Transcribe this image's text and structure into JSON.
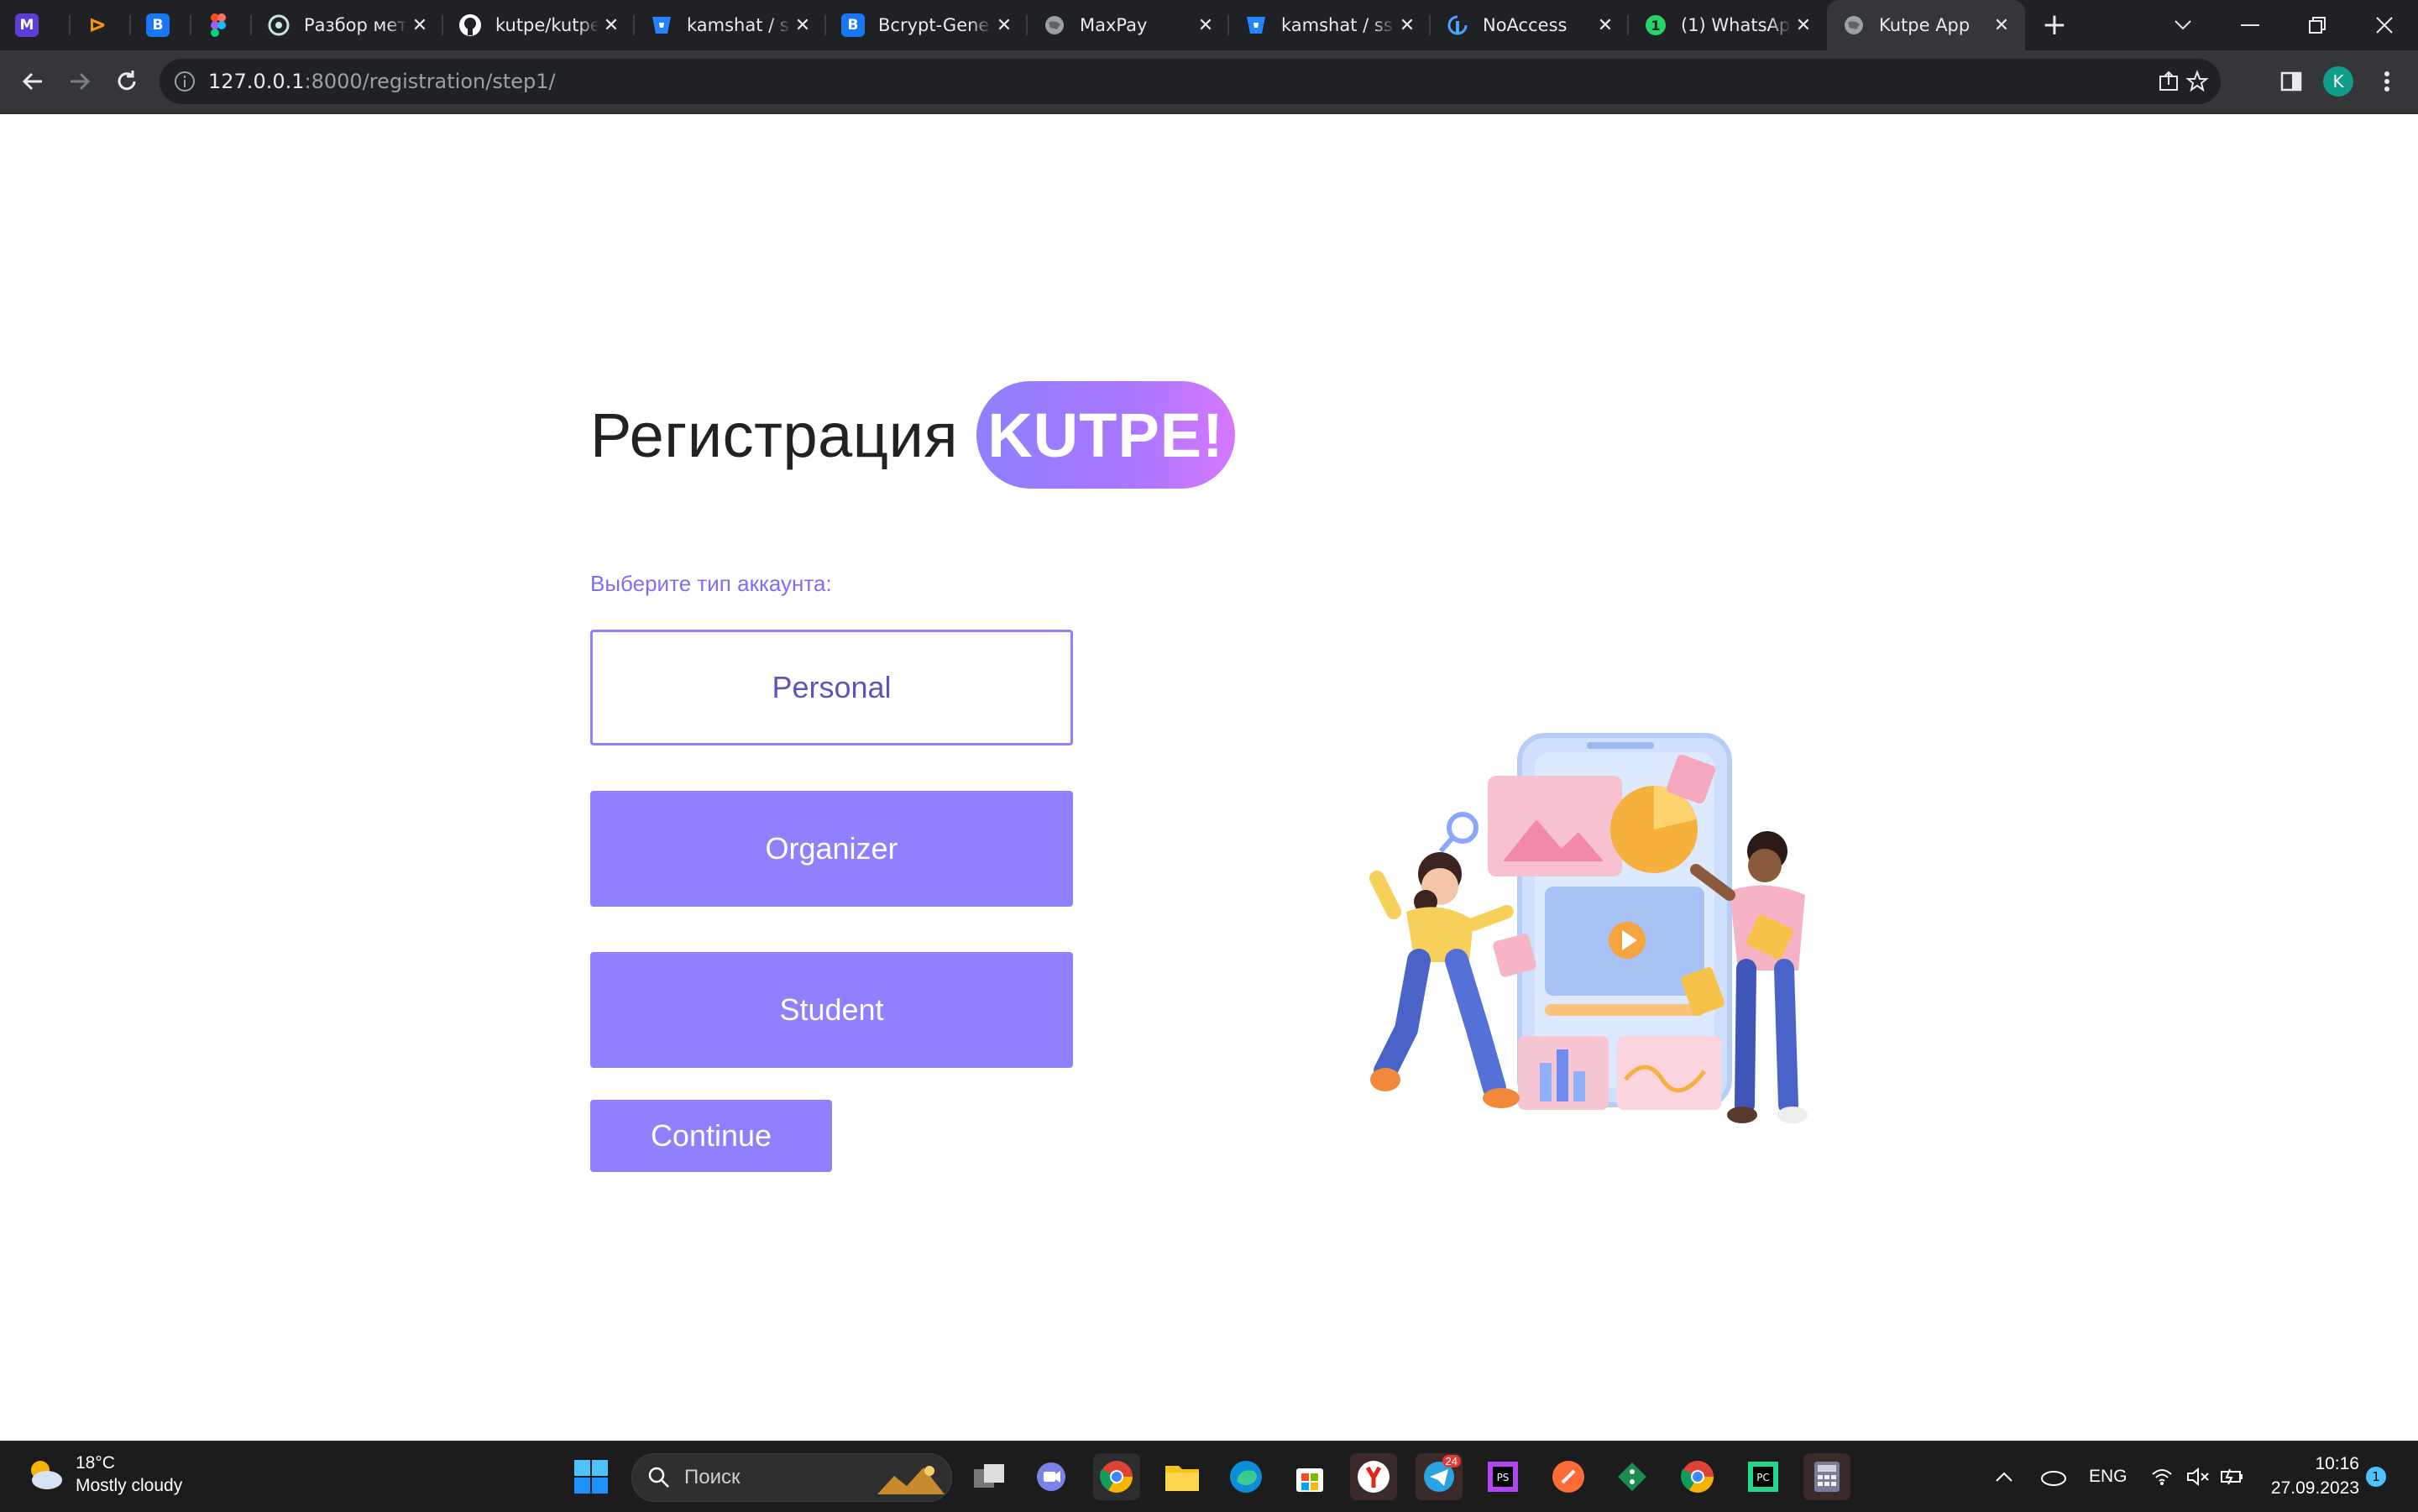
{
  "browser": {
    "tabs": [
      {
        "title": "",
        "favicon": "m-icon",
        "color": "#5c3dd6"
      },
      {
        "title": "",
        "favicon": "arrow-icon",
        "color": "#f29900"
      },
      {
        "title": "",
        "favicon": "b-icon",
        "color": "#1877f2"
      },
      {
        "title": "",
        "favicon": "figma-icon",
        "color": "#f24e1e"
      },
      {
        "title": "Разбор мето",
        "favicon": "chatgpt-icon",
        "color": "#74aa9c"
      },
      {
        "title": "kutpe/kutpe",
        "favicon": "github-icon",
        "color": "#ffffff"
      },
      {
        "title": "kamshat / ss",
        "favicon": "bitbucket-icon",
        "color": "#2684ff"
      },
      {
        "title": "Bcrypt-Gene",
        "favicon": "b-icon",
        "color": "#1877f2"
      },
      {
        "title": "MaxPay",
        "favicon": "globe-icon",
        "color": "#9aa0a6"
      },
      {
        "title": "kamshat / ss",
        "favicon": "bitbucket-icon",
        "color": "#2684ff"
      },
      {
        "title": "NoAccess",
        "favicon": "noaccess-icon",
        "color": "#1a73e8"
      },
      {
        "title": "(1) WhatsAp",
        "favicon": "whatsapp-icon",
        "color": "#25d366"
      },
      {
        "title": "Kutpe App",
        "favicon": "globe-icon",
        "color": "#9aa0a6"
      }
    ],
    "url_host": "127.0.0.1",
    "url_path": ":8000/registration/step1/",
    "profile_initial": "K"
  },
  "page": {
    "title": "Регистрация",
    "brand": "KUTPE!",
    "account_label": "Выберите тип аккаунта:",
    "options": [
      {
        "label": "Personal",
        "selected": true
      },
      {
        "label": "Organizer",
        "selected": false
      },
      {
        "label": "Student",
        "selected": false
      }
    ],
    "continue_label": "Continue",
    "accent_color": "#8f80ff"
  },
  "taskbar": {
    "temperature": "18°C",
    "weather": "Mostly cloudy",
    "search_placeholder": "Поиск",
    "language": "ENG",
    "time": "10:16",
    "date": "27.09.2023",
    "notification_count": "1",
    "telegram_badge": "24"
  }
}
